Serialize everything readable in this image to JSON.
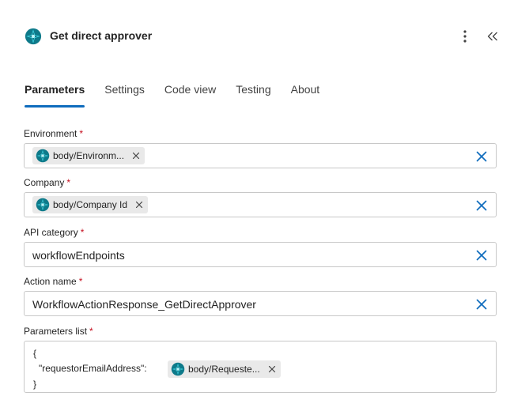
{
  "header": {
    "title": "Get direct approver",
    "more_icon": "more-vertical-icon",
    "collapse_icon": "double-chevron-left-icon"
  },
  "tabs": [
    {
      "label": "Parameters",
      "active": true
    },
    {
      "label": "Settings",
      "active": false
    },
    {
      "label": "Code view",
      "active": false
    },
    {
      "label": "Testing",
      "active": false
    },
    {
      "label": "About",
      "active": false
    }
  ],
  "fields": {
    "environment": {
      "label": "Environment",
      "required": "*",
      "token": "body/Environm..."
    },
    "company": {
      "label": "Company",
      "required": "*",
      "token": "body/Company Id"
    },
    "api_category": {
      "label": "API category",
      "required": "*",
      "value": "workflowEndpoints"
    },
    "action_name": {
      "label": "Action name",
      "required": "*",
      "value": "WorkflowActionResponse_GetDirectApprover"
    },
    "parameters_list": {
      "label": "Parameters list",
      "required": "*",
      "open_brace": "{",
      "key": "\"requestorEmailAddress\":",
      "token": "body/Requeste...",
      "close_brace": "}"
    }
  },
  "colors": {
    "accent": "#0f6cbd",
    "required": "#c50f1f",
    "token_bg": "#e9e9e9",
    "icon_teal": "#0fb5c6"
  }
}
